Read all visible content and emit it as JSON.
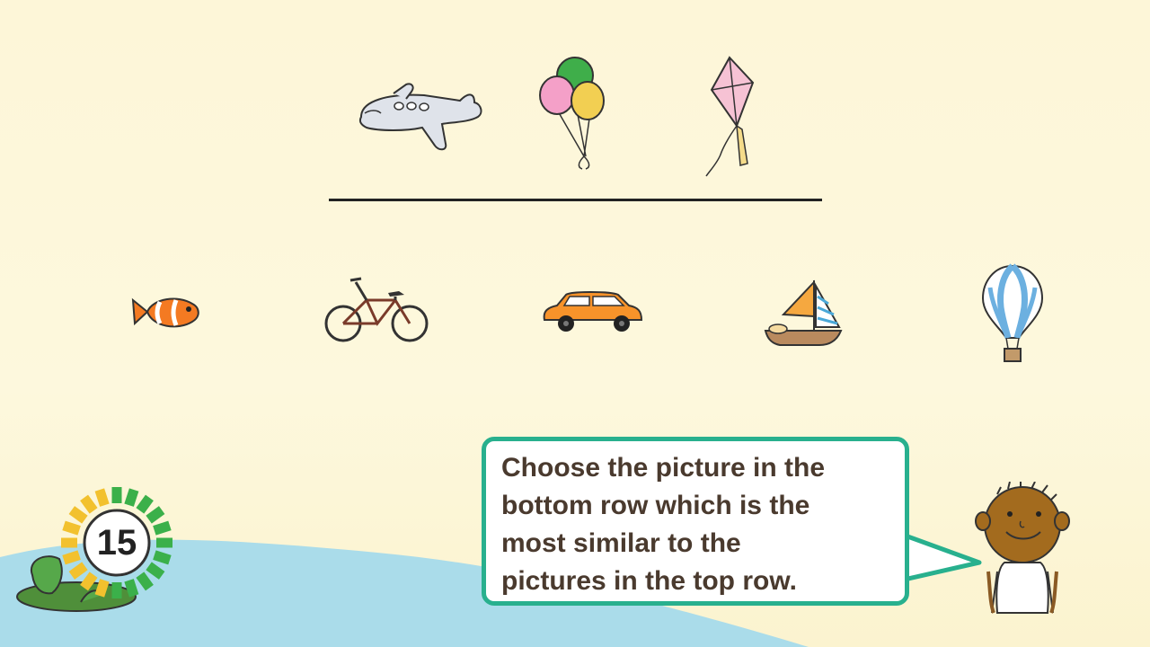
{
  "instruction": {
    "text": "Choose the picture in the\nbottom row which is the\nmost similar to the\npictures in the top row."
  },
  "timer": {
    "value": "15",
    "progress_fraction": 0.55
  },
  "top_row": [
    {
      "name": "airplane-icon"
    },
    {
      "name": "balloons-icon"
    },
    {
      "name": "kite-icon"
    }
  ],
  "bottom_row": [
    {
      "name": "fish-icon"
    },
    {
      "name": "bicycle-icon"
    },
    {
      "name": "car-icon"
    },
    {
      "name": "sailboat-icon"
    },
    {
      "name": "hot-air-balloon-icon"
    }
  ],
  "colors": {
    "background": "#fdf6d8",
    "ground": "#a9dbea",
    "bubble_border": "#28b08e",
    "text": "#4a3a2e",
    "timer_green": "#3bb04a",
    "timer_yellow": "#f2c12e"
  }
}
